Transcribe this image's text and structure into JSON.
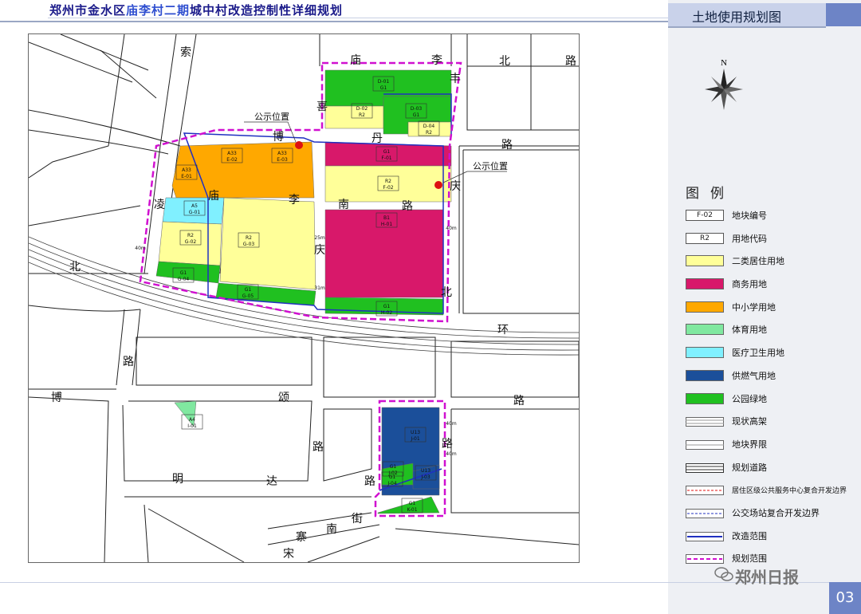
{
  "header": {
    "title_prefix": "郑州市金水区",
    "title_highlight": "庙李村二期",
    "title_suffix": "城中村改造控制性详细规划",
    "panel_title": "土地使用规划图",
    "page_number": "03"
  },
  "compass": {
    "label": "N"
  },
  "legend": {
    "title": "图例",
    "items": [
      {
        "swatch": "F-02",
        "label": "地块编号",
        "kind": "code"
      },
      {
        "swatch": "R2",
        "label": "用地代码",
        "kind": "code"
      },
      {
        "label": "二类居住用地",
        "color": "#ffff99",
        "kind": "fill"
      },
      {
        "label": "商务用地",
        "color": "#d8186a",
        "kind": "fill"
      },
      {
        "label": "中小学用地",
        "color": "#ffa800",
        "kind": "fill"
      },
      {
        "label": "体育用地",
        "color": "#80e8a0",
        "kind": "fill"
      },
      {
        "label": "医疗卫生用地",
        "color": "#80f0ff",
        "kind": "fill"
      },
      {
        "label": "供燃气用地",
        "color": "#1b4f9a",
        "kind": "fill"
      },
      {
        "label": "公园绿地",
        "color": "#20c020",
        "kind": "fill"
      },
      {
        "label": "现状高架",
        "kind": "elevated"
      },
      {
        "label": "地块界限",
        "kind": "boundary"
      },
      {
        "label": "规划道路",
        "kind": "road"
      },
      {
        "label": "居住区级公共服务中心复合开发边界",
        "kind": "red-dash"
      },
      {
        "label": "公交场站复合开发边界",
        "kind": "blue-dash"
      },
      {
        "label": "改造范围",
        "kind": "blue-solid"
      },
      {
        "label": "规划范围",
        "kind": "magenta-dash"
      }
    ]
  },
  "map": {
    "road_chars": [
      {
        "text": "索"
      },
      {
        "text": "庙"
      },
      {
        "text": "李"
      },
      {
        "text": "丰"
      },
      {
        "text": "北"
      },
      {
        "text": "路"
      },
      {
        "text": "博"
      },
      {
        "text": "丹"
      },
      {
        "text": "路"
      },
      {
        "text": "凌"
      },
      {
        "text": "庙"
      },
      {
        "text": "李"
      },
      {
        "text": "南"
      },
      {
        "text": "路"
      },
      {
        "text": "庆"
      },
      {
        "text": "北"
      },
      {
        "text": "庆"
      },
      {
        "text": "北"
      },
      {
        "text": "环"
      },
      {
        "text": "路"
      },
      {
        "text": "博"
      },
      {
        "text": "颂"
      },
      {
        "text": "路"
      },
      {
        "text": "路"
      },
      {
        "text": "路"
      },
      {
        "text": "明"
      },
      {
        "text": "达"
      },
      {
        "text": "路"
      },
      {
        "text": "街"
      },
      {
        "text": "南"
      },
      {
        "text": "寨"
      },
      {
        "text": "宋"
      },
      {
        "text": "喜"
      }
    ],
    "notice_labels": [
      "公示位置",
      "公示位置"
    ],
    "parcels": [
      {
        "code": "D-01",
        "use": "G1"
      },
      {
        "code": "D-02",
        "use": "R2"
      },
      {
        "code": "D-03",
        "use": "G1"
      },
      {
        "code": "D-04",
        "use": "R2"
      },
      {
        "code": "A33",
        "use": "E-01"
      },
      {
        "code": "A33",
        "use": "E-02"
      },
      {
        "code": "A33",
        "use": "E-03"
      },
      {
        "code": "G1",
        "use": "F-01"
      },
      {
        "code": "R2",
        "use": "F-02"
      },
      {
        "code": "A5",
        "use": "G-01"
      },
      {
        "code": "R2",
        "use": "G-02"
      },
      {
        "code": "R2",
        "use": "G-03"
      },
      {
        "code": "G1",
        "use": "G-04"
      },
      {
        "code": "G1",
        "use": "G-05"
      },
      {
        "code": "B1",
        "use": "H-01"
      },
      {
        "code": "G1",
        "use": "H-02"
      },
      {
        "code": "A4",
        "use": "I-01"
      },
      {
        "code": "U13",
        "use": "J-01"
      },
      {
        "code": "G1",
        "use": "J-02"
      },
      {
        "code": "U13",
        "use": "J-03"
      },
      {
        "code": "G1",
        "use": "J-04"
      },
      {
        "code": "G1",
        "use": "K-01"
      }
    ],
    "road_width_labels": [
      "25m",
      "31m",
      "40m",
      "40m",
      "40m",
      "40m"
    ]
  },
  "watermark": {
    "text": "郑州日报"
  },
  "colors": {
    "residential": "#ffff99",
    "commercial": "#d8186a",
    "school": "#ffa800",
    "sports": "#80e8a0",
    "medical": "#80f0ff",
    "gas": "#1b4f9a",
    "park": "#20c020",
    "reform_boundary": "#2030c0",
    "plan_boundary": "#d010d0"
  }
}
